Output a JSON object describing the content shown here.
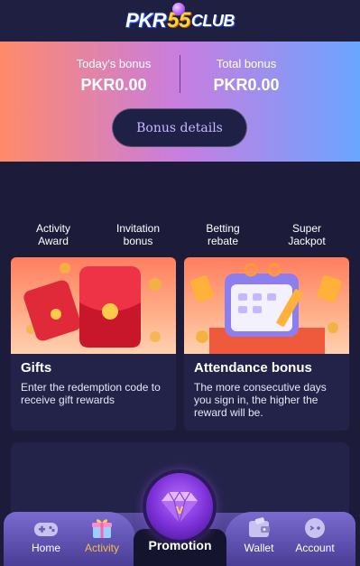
{
  "header": {
    "logo_part1": "PKR",
    "logo_part2": "55",
    "logo_part3": "CLUB"
  },
  "bonus": {
    "today_label": "Today's bonus",
    "today_value": "PKR0.00",
    "total_label": "Total bonus",
    "total_value": "PKR0.00",
    "details_button": "Bonus details"
  },
  "tabs": [
    {
      "line1": "Activity",
      "line2": "Award"
    },
    {
      "line1": "Invitation",
      "line2": "bonus"
    },
    {
      "line1": "Betting",
      "line2": "rebate"
    },
    {
      "line1": "Super",
      "line2": "Jackpot"
    }
  ],
  "cards": [
    {
      "title": "Gifts",
      "description": "Enter the redemption code to receive gift rewards"
    },
    {
      "title": "Attendance bonus",
      "description": "The more consecutive days you sign in, the higher the reward will be."
    }
  ],
  "nav": {
    "home": "Home",
    "activity": "Activity",
    "promotion": "Promotion",
    "wallet": "Wallet",
    "account": "Account"
  },
  "colors": {
    "accent": "#f0c040",
    "background": "#1c1c3a",
    "card": "#23234a"
  }
}
